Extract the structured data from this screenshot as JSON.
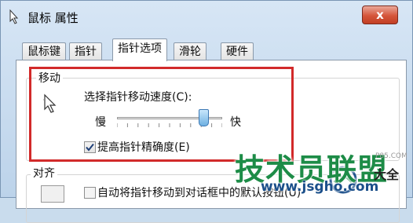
{
  "window": {
    "title": "鼠标 属性",
    "close_glyph": "x"
  },
  "tabs": [
    {
      "label": "鼠标键",
      "active": false
    },
    {
      "label": "指针",
      "active": false
    },
    {
      "label": "指针选项",
      "active": true
    },
    {
      "label": "滑轮",
      "active": false
    },
    {
      "label": "硬件",
      "active": false
    }
  ],
  "motion": {
    "group_label": "移动",
    "speed_label": "选择指针移动速度(C):",
    "slow_label": "慢",
    "fast_label": "快",
    "speed_level": 0.82,
    "precision_label": "提高指针精确度(E)",
    "precision_checked": true
  },
  "snap": {
    "group_label": "对齐",
    "checkbox_label": "自动将指针移动到对话框中的默认按钮(U)",
    "checked": false
  },
  "watermark": {
    "title": "技术员联盟",
    "url": "www.jsgho.com",
    "side_text": "大全",
    "small_text": "P85.COM"
  },
  "colors": {
    "highlight": "#d22a2a",
    "watermark_green": "#1d8c47",
    "watermark_blue": "#1b4f8a"
  },
  "icons": {
    "title": "mouse-properties-icon",
    "motion": "pointer-motion-icon",
    "snap": "snap-to-icon",
    "close": "close-icon"
  }
}
